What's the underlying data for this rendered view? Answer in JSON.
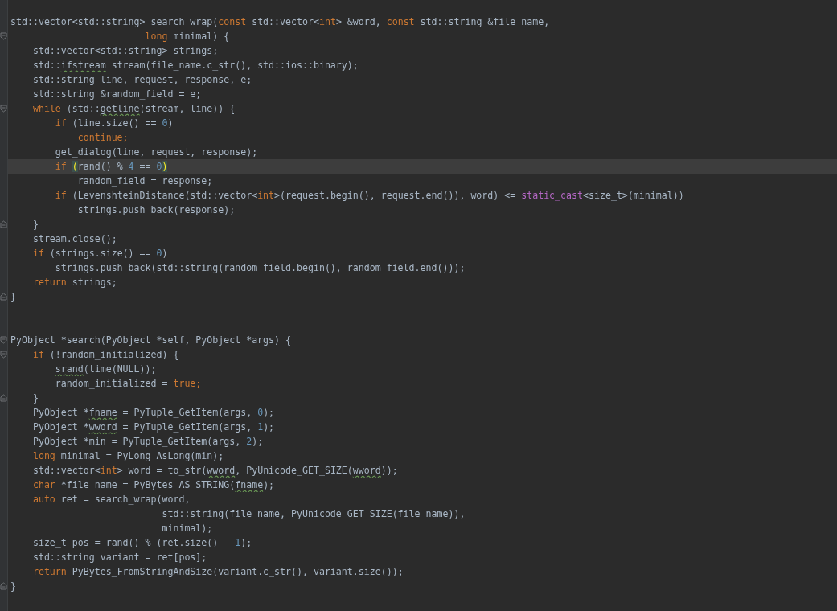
{
  "editor": {
    "lines": [
      {
        "current": false,
        "segments": [
          {
            "text": "std::vector<std::string> search_wrap(",
            "kind": "code"
          },
          {
            "text": "const",
            "kind": "keyword"
          },
          {
            "text": " std::vector<",
            "kind": "code"
          },
          {
            "text": "int",
            "kind": "keyword"
          },
          {
            "text": "> &word, ",
            "kind": "code"
          },
          {
            "text": "const",
            "kind": "keyword"
          },
          {
            "text": " std::string &file_name,",
            "kind": "code"
          }
        ]
      },
      {
        "current": false,
        "fold_start": true,
        "segments": [
          {
            "text": "                        long",
            "kind": "keyword"
          },
          {
            "text": " minimal) {",
            "kind": "code"
          }
        ]
      },
      {
        "current": false,
        "segments": [
          {
            "text": "    std::vector<std::string> strings;",
            "kind": "code"
          }
        ]
      },
      {
        "current": false,
        "segments": [
          {
            "text": "    std::",
            "kind": "code"
          },
          {
            "text": "ifstream",
            "kind": "typo"
          },
          {
            "text": " stream(file_name.c_str(), std::ios::binary);",
            "kind": "code"
          }
        ]
      },
      {
        "current": false,
        "segments": [
          {
            "text": "    std::string line, request, response, e;",
            "kind": "code"
          }
        ]
      },
      {
        "current": false,
        "segments": [
          {
            "text": "    std::string &random_field = e;",
            "kind": "code"
          }
        ]
      },
      {
        "current": false,
        "fold_start": true,
        "segments": [
          {
            "text": "    while",
            "kind": "keyword"
          },
          {
            "text": " (std::",
            "kind": "code"
          },
          {
            "text": "getline",
            "kind": "typo"
          },
          {
            "text": "(stream, line)) {",
            "kind": "code"
          }
        ]
      },
      {
        "current": false,
        "segments": [
          {
            "text": "        if",
            "kind": "keyword"
          },
          {
            "text": " (line.size() == ",
            "kind": "code"
          },
          {
            "text": "0",
            "kind": "number"
          },
          {
            "text": ")",
            "kind": "code"
          }
        ]
      },
      {
        "current": false,
        "segments": [
          {
            "text": "            continue;",
            "kind": "keyword"
          }
        ]
      },
      {
        "current": false,
        "segments": [
          {
            "text": "        get_dialog(line, request, response);",
            "kind": "code"
          }
        ]
      },
      {
        "current": true,
        "segments": [
          {
            "text": "        if ",
            "kind": "keyword"
          },
          {
            "text": "(",
            "kind": "brace_match"
          },
          {
            "text": "rand() % ",
            "kind": "code"
          },
          {
            "text": "4",
            "kind": "number"
          },
          {
            "text": " == ",
            "kind": "code"
          },
          {
            "text": "0",
            "kind": "number"
          },
          {
            "text": ")",
            "kind": "brace_match"
          }
        ]
      },
      {
        "current": false,
        "segments": [
          {
            "text": "            random_field = response;",
            "kind": "code"
          }
        ]
      },
      {
        "current": false,
        "segments": [
          {
            "text": "        if",
            "kind": "keyword"
          },
          {
            "text": " (LevenshteinDistance(std::vector<",
            "kind": "code"
          },
          {
            "text": "int",
            "kind": "keyword"
          },
          {
            "text": ">(request.begin(), request.end()), word) <= ",
            "kind": "code"
          },
          {
            "text": "static_cast",
            "kind": "intrinsic"
          },
          {
            "text": "<size_t>(minimal))",
            "kind": "code"
          }
        ]
      },
      {
        "current": false,
        "segments": [
          {
            "text": "            strings.push_back(response);",
            "kind": "code"
          }
        ]
      },
      {
        "current": false,
        "fold_end": true,
        "segments": [
          {
            "text": "    }",
            "kind": "code"
          }
        ]
      },
      {
        "current": false,
        "segments": [
          {
            "text": "    stream.close();",
            "kind": "code"
          }
        ]
      },
      {
        "current": false,
        "segments": [
          {
            "text": "    if",
            "kind": "keyword"
          },
          {
            "text": " (strings.size() == ",
            "kind": "code"
          },
          {
            "text": "0",
            "kind": "number"
          },
          {
            "text": ")",
            "kind": "code"
          }
        ]
      },
      {
        "current": false,
        "segments": [
          {
            "text": "        strings.push_back(std::string(random_field.begin(), random_field.end()));",
            "kind": "code"
          }
        ]
      },
      {
        "current": false,
        "segments": [
          {
            "text": "    return",
            "kind": "keyword"
          },
          {
            "text": " strings;",
            "kind": "code"
          }
        ]
      },
      {
        "current": false,
        "fold_end": true,
        "segments": [
          {
            "text": "}",
            "kind": "code"
          }
        ]
      },
      {
        "current": false
      },
      {
        "current": false
      },
      {
        "current": false,
        "fold_start": true,
        "segments": [
          {
            "text": "PyObject *search(PyObject *self, PyObject *args) {",
            "kind": "code"
          }
        ]
      },
      {
        "current": false,
        "fold_start": true,
        "segments": [
          {
            "text": "    if",
            "kind": "keyword"
          },
          {
            "text": " (!random_initialized) {",
            "kind": "code"
          }
        ]
      },
      {
        "current": false,
        "segments": [
          {
            "text": "        srand",
            "kind": "typo"
          },
          {
            "text": "(time(NULL));",
            "kind": "code"
          }
        ]
      },
      {
        "current": false,
        "segments": [
          {
            "text": "        random_initialized = ",
            "kind": "code"
          },
          {
            "text": "true;",
            "kind": "keyword"
          }
        ]
      },
      {
        "current": false,
        "fold_end": true,
        "segments": [
          {
            "text": "    }",
            "kind": "code"
          }
        ]
      },
      {
        "current": false,
        "segments": [
          {
            "text": "    PyObject *",
            "kind": "code"
          },
          {
            "text": "fname",
            "kind": "typo"
          },
          {
            "text": " = PyTuple_GetItem(args, ",
            "kind": "code"
          },
          {
            "text": "0",
            "kind": "number"
          },
          {
            "text": ");",
            "kind": "code"
          }
        ]
      },
      {
        "current": false,
        "segments": [
          {
            "text": "    PyObject *",
            "kind": "code"
          },
          {
            "text": "wword",
            "kind": "typo"
          },
          {
            "text": " = PyTuple_GetItem(args, ",
            "kind": "code"
          },
          {
            "text": "1",
            "kind": "number"
          },
          {
            "text": ");",
            "kind": "code"
          }
        ]
      },
      {
        "current": false,
        "segments": [
          {
            "text": "    PyObject *min = PyTuple_GetItem(args, ",
            "kind": "code"
          },
          {
            "text": "2",
            "kind": "number"
          },
          {
            "text": ");",
            "kind": "code"
          }
        ]
      },
      {
        "current": false,
        "segments": [
          {
            "text": "    long",
            "kind": "keyword"
          },
          {
            "text": " minimal = PyLong_AsLong(min);",
            "kind": "code"
          }
        ]
      },
      {
        "current": false,
        "segments": [
          {
            "text": "    std::vector<",
            "kind": "code"
          },
          {
            "text": "int",
            "kind": "keyword"
          },
          {
            "text": "> word = to_str(",
            "kind": "code"
          },
          {
            "text": "wword",
            "kind": "typo"
          },
          {
            "text": ", PyUnicode_GET_SIZE(",
            "kind": "code"
          },
          {
            "text": "wword",
            "kind": "typo"
          },
          {
            "text": "));",
            "kind": "code"
          }
        ]
      },
      {
        "current": false,
        "segments": [
          {
            "text": "    char",
            "kind": "keyword"
          },
          {
            "text": " *file_name = PyBytes_AS_STRING(",
            "kind": "code"
          },
          {
            "text": "fname",
            "kind": "typo"
          },
          {
            "text": ");",
            "kind": "code"
          }
        ]
      },
      {
        "current": false,
        "segments": [
          {
            "text": "    auto",
            "kind": "keyword"
          },
          {
            "text": " ret = search_wrap(word,",
            "kind": "code"
          }
        ]
      },
      {
        "current": false,
        "segments": [
          {
            "text": "                           std::string(file_name, PyUnicode_GET_SIZE(file_name)),",
            "kind": "code"
          }
        ]
      },
      {
        "current": false,
        "segments": [
          {
            "text": "                           minimal);",
            "kind": "code"
          }
        ]
      },
      {
        "current": false,
        "segments": [
          {
            "text": "    size_t pos = rand() % (ret.size() - ",
            "kind": "code"
          },
          {
            "text": "1",
            "kind": "number"
          },
          {
            "text": ");",
            "kind": "code"
          }
        ]
      },
      {
        "current": false,
        "segments": [
          {
            "text": "    std::string variant = ret[pos];",
            "kind": "code"
          }
        ]
      },
      {
        "current": false,
        "segments": [
          {
            "text": "    return",
            "kind": "keyword"
          },
          {
            "text": " PyBytes_FromStringAndSize(variant.c_str(), variant.size());",
            "kind": "code"
          }
        ]
      },
      {
        "current": false,
        "fold_end": true,
        "segments": [
          {
            "text": "}",
            "kind": "code"
          }
        ]
      }
    ]
  }
}
